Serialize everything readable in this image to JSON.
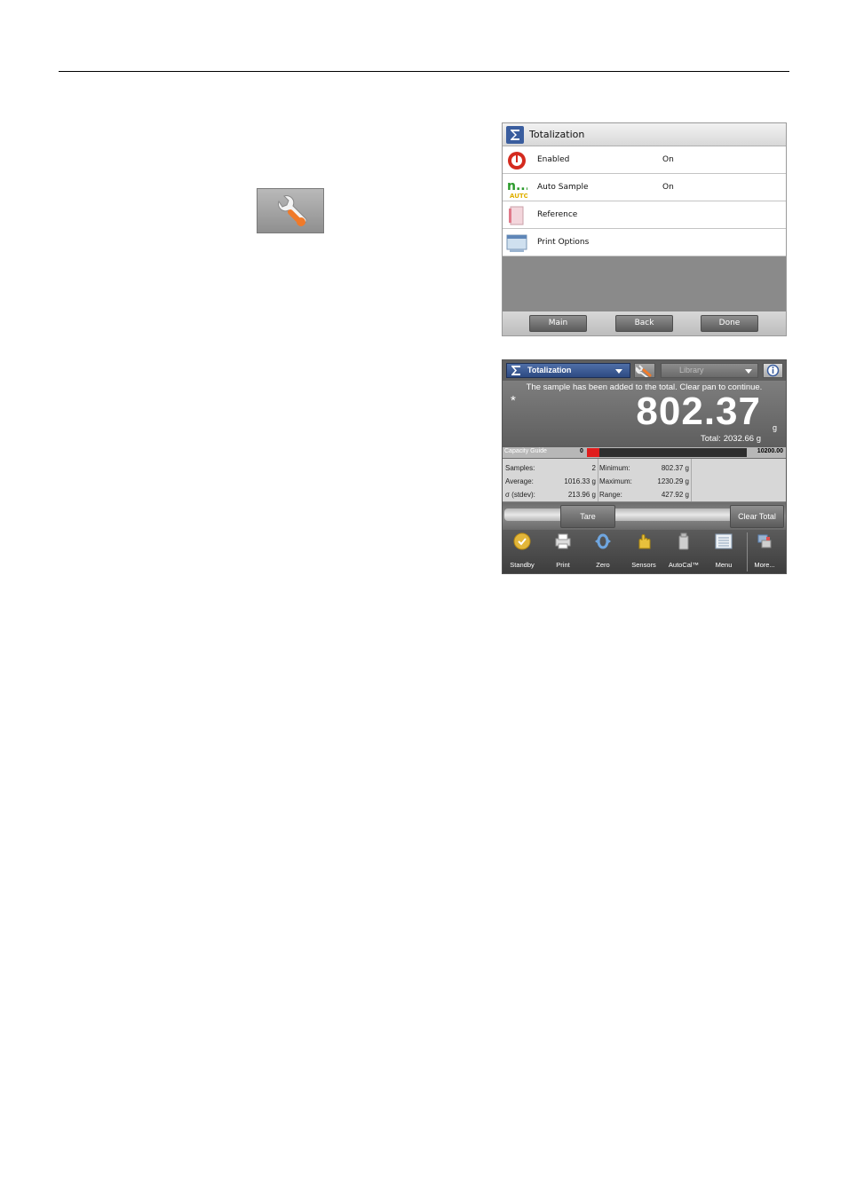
{
  "setup_screen": {
    "title": "Totalization",
    "rows": [
      {
        "label": "Enabled",
        "value": "On",
        "icon": "enabled-icon"
      },
      {
        "label": "Auto Sample",
        "value": "On",
        "icon": "auto-sample-icon"
      },
      {
        "label": "Reference",
        "value": "",
        "icon": "reference-icon"
      },
      {
        "label": "Print Options",
        "value": "",
        "icon": "print-options-icon"
      }
    ],
    "footer": {
      "main": "Main",
      "back": "Back",
      "done": "Done"
    }
  },
  "app_screen": {
    "mode": "Totalization",
    "library": "Library",
    "message": "The sample has been added to the total.  Clear pan to continue.",
    "stable_marker": "*",
    "weight": "802.37",
    "unit": "g",
    "total_label": "Total:",
    "total_value": "2032.66 g",
    "capacity": {
      "label": "Capacity Guide",
      "min": "0",
      "max": "10200.00",
      "fill_fraction": 0.08
    },
    "stats": {
      "samples_label": "Samples:",
      "samples_value": "2",
      "average_label": "Average:",
      "average_value": "1016.33 g",
      "stdev_label": "σ (stdev):",
      "stdev_value": "213.96 g",
      "minimum_label": "Minimum:",
      "minimum_value": "802.37 g",
      "maximum_label": "Maximum:",
      "maximum_value": "1230.29 g",
      "range_label": "Range:",
      "range_value": "427.92 g"
    },
    "actions": {
      "tare": "Tare",
      "clear_total": "Clear Total"
    },
    "toolbar": [
      "Standby",
      "Print",
      "Zero",
      "Sensors",
      "AutoCal™",
      "Menu",
      "More..."
    ]
  },
  "colors": {
    "accent_blue": "#2d4a82",
    "capacity_red": "#e11d1d",
    "wrench_orange": "#f07a2a"
  }
}
